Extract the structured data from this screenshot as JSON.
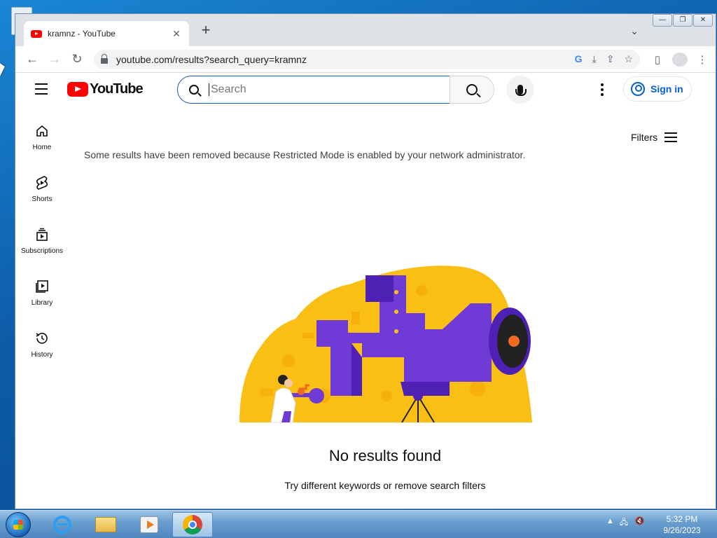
{
  "browser": {
    "tab_title": "kramnz - YouTube",
    "tab_close": "✕",
    "new_tab": "+",
    "url": "youtube.com/results?search_query=kramnz"
  },
  "youtube": {
    "search": {
      "placeholder": "Search",
      "value": ""
    },
    "signin_label": "Sign in",
    "guide": [
      {
        "label": "Home",
        "icon": "home-icon"
      },
      {
        "label": "Shorts",
        "icon": "shorts-icon"
      },
      {
        "label": "Subscriptions",
        "icon": "subscriptions-icon"
      },
      {
        "label": "Library",
        "icon": "library-icon"
      },
      {
        "label": "History",
        "icon": "history-icon"
      }
    ],
    "filters_label": "Filters",
    "restricted_notice": "Some results have been removed because Restricted Mode is enabled by your network administrator.",
    "no_results_title": "No results found",
    "no_results_subtitle": "Try different keywords or remove search filters"
  },
  "taskbar": {
    "time": "5:32 PM",
    "date": "9/26/2023"
  },
  "colors": {
    "youtube_red": "#ff0000",
    "link_blue": "#065fd4",
    "illustration_yellow": "#f9bf14",
    "illustration_purple": "#6f3ad6"
  }
}
